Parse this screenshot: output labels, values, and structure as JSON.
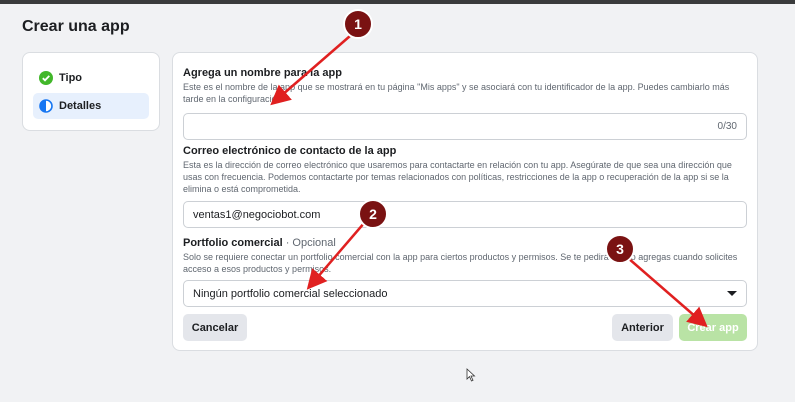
{
  "page": {
    "title": "Crear una app"
  },
  "steps": [
    {
      "label": "Tipo",
      "state": "done",
      "icon": "check-circle-icon"
    },
    {
      "label": "Detalles",
      "state": "active",
      "icon": "half-circle-icon"
    }
  ],
  "name_field": {
    "label": "Agrega un nombre para la app",
    "help": "Este es el nombre de la app que se mostrará en tu página \"Mis apps\" y se asociará con tu identificador de la app. Puedes cambiarlo más tarde en la configuración.",
    "value": "",
    "counter": "0/30"
  },
  "email_field": {
    "label": "Correo electrónico de contacto de la app",
    "help": "Esta es la dirección de correo electrónico que usaremos para contactarte en relación con tu app. Asegúrate de que sea una dirección que usas con frecuencia. Podemos contactarte por temas relacionados con políticas, restricciones de la app o recuperación de la app si se la elimina o está comprometida.",
    "value": "ventas1@negociobot.com"
  },
  "portfolio_field": {
    "label": "Portfolio comercial",
    "optional": "· Opcional",
    "help": "Solo se requiere conectar un portfolio comercial con la app para ciertos productos y permisos. Se te pedirá que lo agregas cuando solicites acceso a esos productos y permisos.",
    "selected": "Ningún portfolio comercial seleccionado"
  },
  "buttons": {
    "cancel": "Cancelar",
    "back": "Anterior",
    "create": "Crear app"
  },
  "annotations": [
    {
      "number": "1"
    },
    {
      "number": "2"
    },
    {
      "number": "3"
    }
  ],
  "colors": {
    "accent_green": "#b9e3a5",
    "check_green": "#42b72a",
    "blue": "#1877f2",
    "marker_red": "#7a1212",
    "arrow_red": "#e02020"
  }
}
